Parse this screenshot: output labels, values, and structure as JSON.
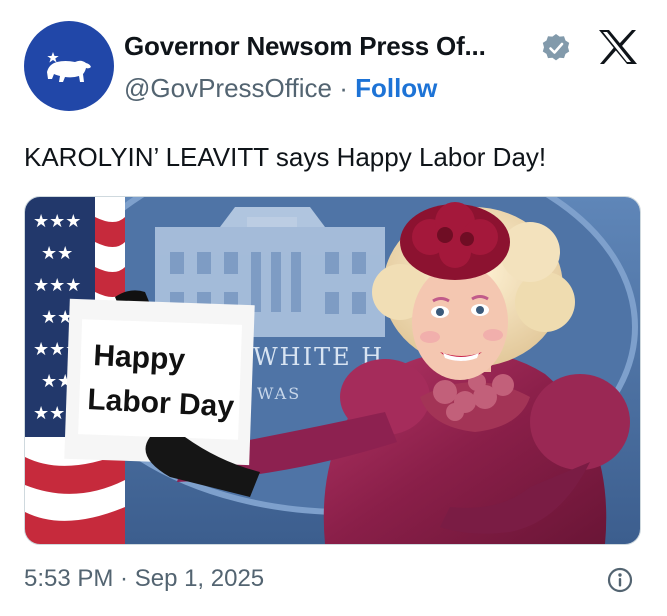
{
  "author": {
    "name": "Governor Newsom Press Of...",
    "handle": "@GovPressOffice",
    "separator": " · ",
    "follow_label": "Follow",
    "avatar_icon": "california-bear-icon",
    "verified_icon": "verified-badge-icon"
  },
  "platform_icon": "x-logo-icon",
  "tweet": {
    "text": "KAROLYIN’ LEAVITT says Happy Labor Day!"
  },
  "media": {
    "sign_line1": "Happy",
    "sign_line2": "Labor Day",
    "backdrop_text1": "WHITE H",
    "backdrop_text2": "WAS"
  },
  "footer": {
    "timestamp": "5:53 PM · Sep 1, 2025",
    "info_icon": "info-icon"
  },
  "colors": {
    "avatar_bg": "#2147a8",
    "follow": "#1d73d6",
    "secondary_text": "#536471",
    "verified_badge": "#829aab"
  }
}
